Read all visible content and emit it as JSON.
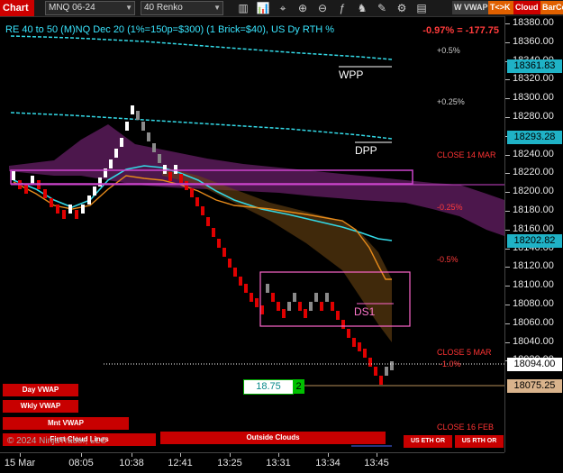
{
  "toolbar": {
    "chart_label": "Chart",
    "symbol": "MNQ 06-24",
    "bartype": "40 Renko",
    "buttons": {
      "wvwap": "W VWAP",
      "tk": "T<>K",
      "cloud": "Cloud",
      "barco": "BarCo"
    },
    "icons": [
      "bars-icon",
      "chart-style-icon",
      "crosshair-icon",
      "zoom-in-icon",
      "zoom-out-icon",
      "indicators-icon",
      "strategy-icon",
      "draw-icon",
      "properties-icon",
      "data-box-icon"
    ]
  },
  "chart": {
    "title": "RE 40 to 50 (M)NQ Dec 20 (1%=150p=$300) (1 Brick=$40), US Dy RTH %",
    "pct_change": "-0.97% = -177.75",
    "labels": {
      "wpp": "WPP",
      "dpp": "DPP",
      "ds1": "DS1",
      "p05": "+0.5%",
      "p025": "+0.25%",
      "close14": "CLOSE 14 MAR",
      "m025": "-0.25%",
      "m05": "-0.5%",
      "close5": "CLOSE 5 MAR",
      "m10": "-1.0%",
      "close16": "CLOSE 16 FEB",
      "copyright": "© 2024 NinjaTrader, LLC"
    },
    "counter": {
      "value": "18.75",
      "badge": "2"
    },
    "vwap_labels": {
      "day": "Day VWAP",
      "wkly": "Wkly VWAP",
      "mnt": "Mnt VWAP",
      "first": "First Cloud Lines",
      "outside": "Outside Clouds",
      "us_eth": "US ETH OR",
      "us_rth": "US RTH OR"
    },
    "price_axis": {
      "ticks": [
        "18380.00",
        "18360.00",
        "18340.00",
        "18320.00",
        "18300.00",
        "18280.00",
        "18260.00",
        "18240.00",
        "18220.00",
        "18200.00",
        "18180.00",
        "18160.00",
        "18140.00",
        "18120.00",
        "18100.00",
        "18080.00",
        "18060.00",
        "18040.00",
        "18020.00"
      ],
      "boxes": [
        "18361.83",
        "18293.28",
        "18202.82",
        "18094.00",
        "18075.25"
      ]
    },
    "time_axis": [
      "15 Mar",
      "08:05",
      "10:38",
      "12:41",
      "13:25",
      "13:31",
      "13:34",
      "13:45"
    ]
  },
  "colors": {
    "up": "#ffffff",
    "down": "#e00000",
    "cyan": "#33d9e6",
    "orange": "#e68a1a",
    "purple": "#8a2a8a",
    "pink": "#ff66cc",
    "red_btn": "#c80000"
  }
}
